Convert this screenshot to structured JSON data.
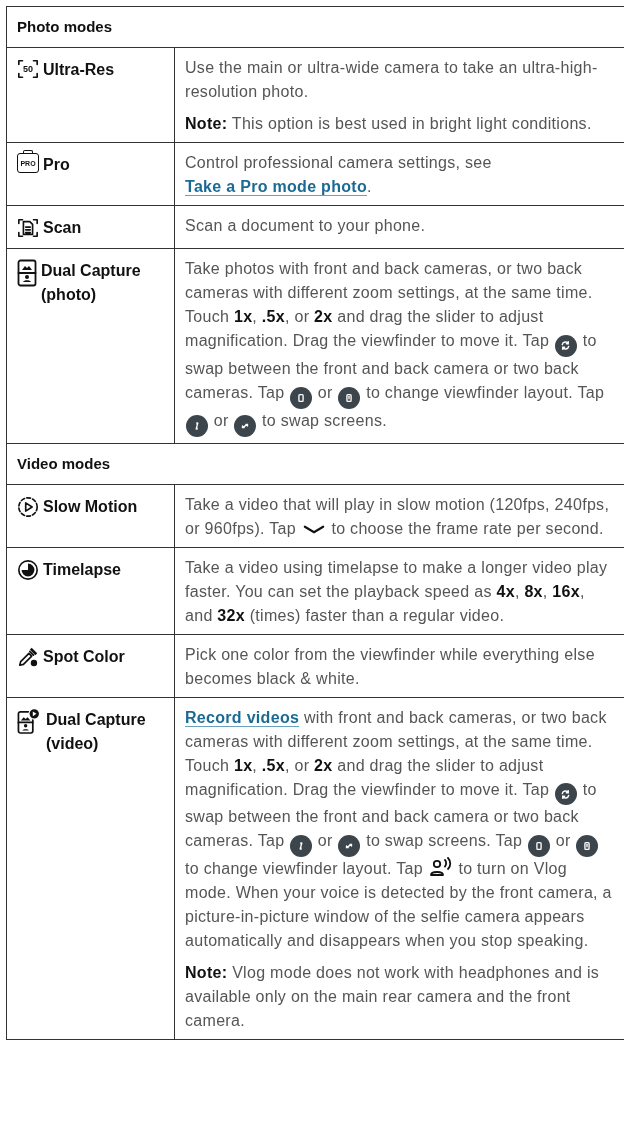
{
  "sections": [
    {
      "title": "Photo modes",
      "rows": [
        {
          "kind": "ultrares",
          "icon_label": "50",
          "name": "Ultra-Res",
          "paragraphs": [
            [
              {
                "kind": "text",
                "text": "Use the main or ultra-wide camera to take an ultra-high-resolution photo."
              }
            ],
            [
              {
                "kind": "text",
                "text": "**Note:** This option is best used in bright light conditions."
              }
            ]
          ]
        },
        {
          "kind": "pro",
          "icon_label": "PRO",
          "name": "Pro",
          "paragraphs": [
            [
              {
                "kind": "text",
                "text": "Control professional camera settings, see "
              },
              {
                "kind": "link",
                "text": "Take a Pro mode photo"
              },
              {
                "kind": "text",
                "text": "."
              }
            ]
          ]
        },
        {
          "kind": "scan",
          "name": "Scan",
          "paragraphs": [
            [
              {
                "kind": "text",
                "text": "Scan a document to your phone."
              }
            ]
          ]
        },
        {
          "kind": "dualphoto",
          "name": "Dual Capture (photo)",
          "paragraphs": [
            [
              {
                "kind": "text",
                "text": "Take photos with front and back cameras, or two back cameras with different zoom settings, at the same time. Touch **1x**, **.5x**, or **2x** and drag the slider to adjust magnification. Drag the viewfinder to move it. Tap "
              },
              {
                "kind": "swap"
              },
              {
                "kind": "text",
                "text": " to swap between the front and back camera or two back cameras. Tap "
              },
              {
                "kind": "single"
              },
              {
                "kind": "text",
                "text": " or "
              },
              {
                "kind": "split"
              },
              {
                "kind": "text",
                "text": " to change viewfinder layout. Tap "
              },
              {
                "kind": "flip"
              },
              {
                "kind": "text",
                "text": " or "
              },
              {
                "kind": "rotate"
              },
              {
                "kind": "text",
                "text": " to swap screens."
              }
            ]
          ]
        }
      ]
    },
    {
      "title": "Video modes",
      "rows": [
        {
          "kind": "slowmo",
          "name": "Slow Motion",
          "paragraphs": [
            [
              {
                "kind": "text",
                "text": "Take a video that will play in slow motion (120fps, 240fps, or 960fps). Tap "
              },
              {
                "kind": "chevron"
              },
              {
                "kind": "text",
                "text": " to choose the frame rate per second."
              }
            ]
          ]
        },
        {
          "kind": "timelapse",
          "name": "Timelapse",
          "paragraphs": [
            [
              {
                "kind": "text",
                "text": "Take a video using timelapse to make a longer video play faster. You can set the playback speed as **4x**, **8x**, **16x**, and **32x** (times) faster than a regular video."
              }
            ]
          ]
        },
        {
          "kind": "spotcolor",
          "name": "Spot Color",
          "paragraphs": [
            [
              {
                "kind": "text",
                "text": "Pick one color from the viewfinder while everything else becomes black & white."
              }
            ]
          ]
        },
        {
          "kind": "dualvideo",
          "name": "Dual Capture (video)",
          "paragraphs": [
            [
              {
                "kind": "link",
                "text": "Record videos"
              },
              {
                "kind": "text",
                "text": " with front and back cameras, or two back cameras with different zoom settings, at the same time. Touch **1x**, **.5x**, or **2x** and drag the slider to adjust magnification. Drag the viewfinder to move it. Tap "
              },
              {
                "kind": "swap"
              },
              {
                "kind": "text",
                "text": " to swap between the front and back camera or two back cameras. Tap "
              },
              {
                "kind": "flip"
              },
              {
                "kind": "text",
                "text": " or "
              },
              {
                "kind": "rotate"
              },
              {
                "kind": "text",
                "text": " to swap screens. Tap "
              },
              {
                "kind": "single"
              },
              {
                "kind": "text",
                "text": " or "
              },
              {
                "kind": "split"
              },
              {
                "kind": "text",
                "text": " to change viewfinder layout. Tap "
              },
              {
                "kind": "vlog"
              },
              {
                "kind": "text",
                "text": " to turn on Vlog mode. When your voice is detected by the front camera, a picture-in-picture window of the selfie camera appears automatically and disappears when you stop speaking."
              }
            ],
            [
              {
                "kind": "text",
                "text": "**Note:** Vlog mode does not work with headphones and is available only on the main rear camera and the front camera."
              }
            ]
          ]
        }
      ]
    }
  ]
}
